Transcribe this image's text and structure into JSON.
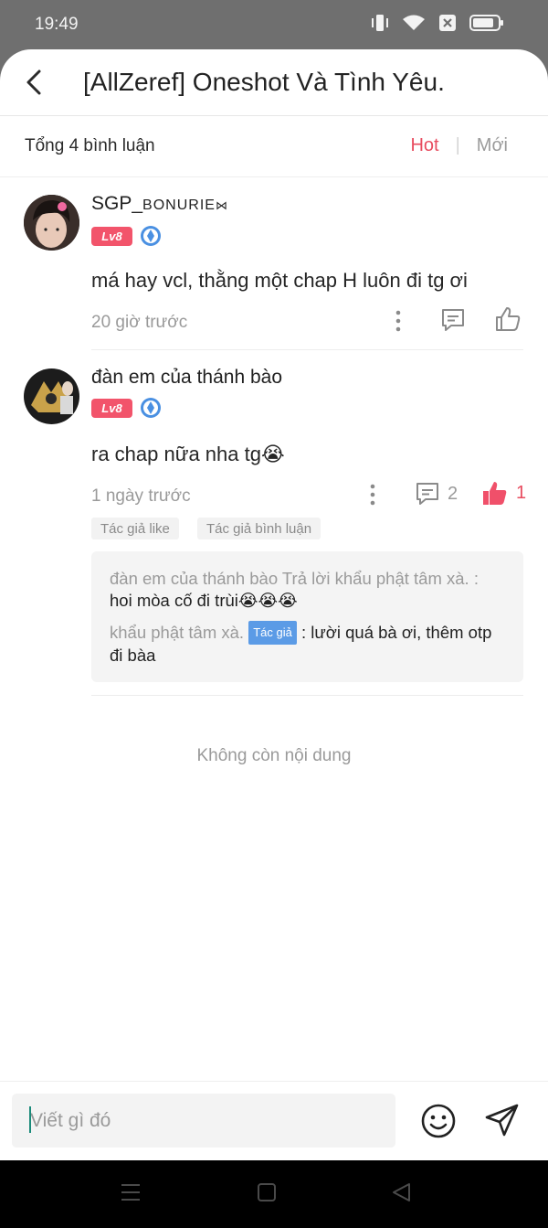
{
  "status_bar": {
    "time": "19:49"
  },
  "header": {
    "title": "[AllZeref] Oneshot Và Tình Yêu."
  },
  "subheader": {
    "total": "Tổng 4 bình luận",
    "sort_hot": "Hot",
    "sort_new": "Mới"
  },
  "comments": [
    {
      "username": "SGP_",
      "username_suffix": "BONURIE",
      "username_symbol": "⋈",
      "level": "Lv8",
      "text": "má hay vcl, thằng một chap H luôn đi tg ơi",
      "time": "20 giờ trước"
    },
    {
      "username": "đàn em của thánh bào",
      "level": "Lv8",
      "text": "ra chap nữa nha tg😭",
      "time": "1 ngày trước",
      "reply_count": "2",
      "like_count": "1",
      "tags": [
        "Tác giả like",
        "Tác giả bình luận"
      ],
      "replies": [
        {
          "prefix": "đàn em của thánh bào Trả lời khẩu phật tâm xà. :",
          "text": "hoi mòa cố đi trùi😭😭😭"
        },
        {
          "prefix": "khẩu phật tâm xà.",
          "badge": "Tác giả",
          "text": ": lười quá bà ơi, thêm otp đi bàa"
        }
      ]
    }
  ],
  "end_text": "Không còn nội dung",
  "input": {
    "placeholder": "Viết gì đó"
  },
  "colors": {
    "accent": "#e84c5f",
    "level_badge": "#f2546b",
    "author_badge": "#5b9be6"
  }
}
